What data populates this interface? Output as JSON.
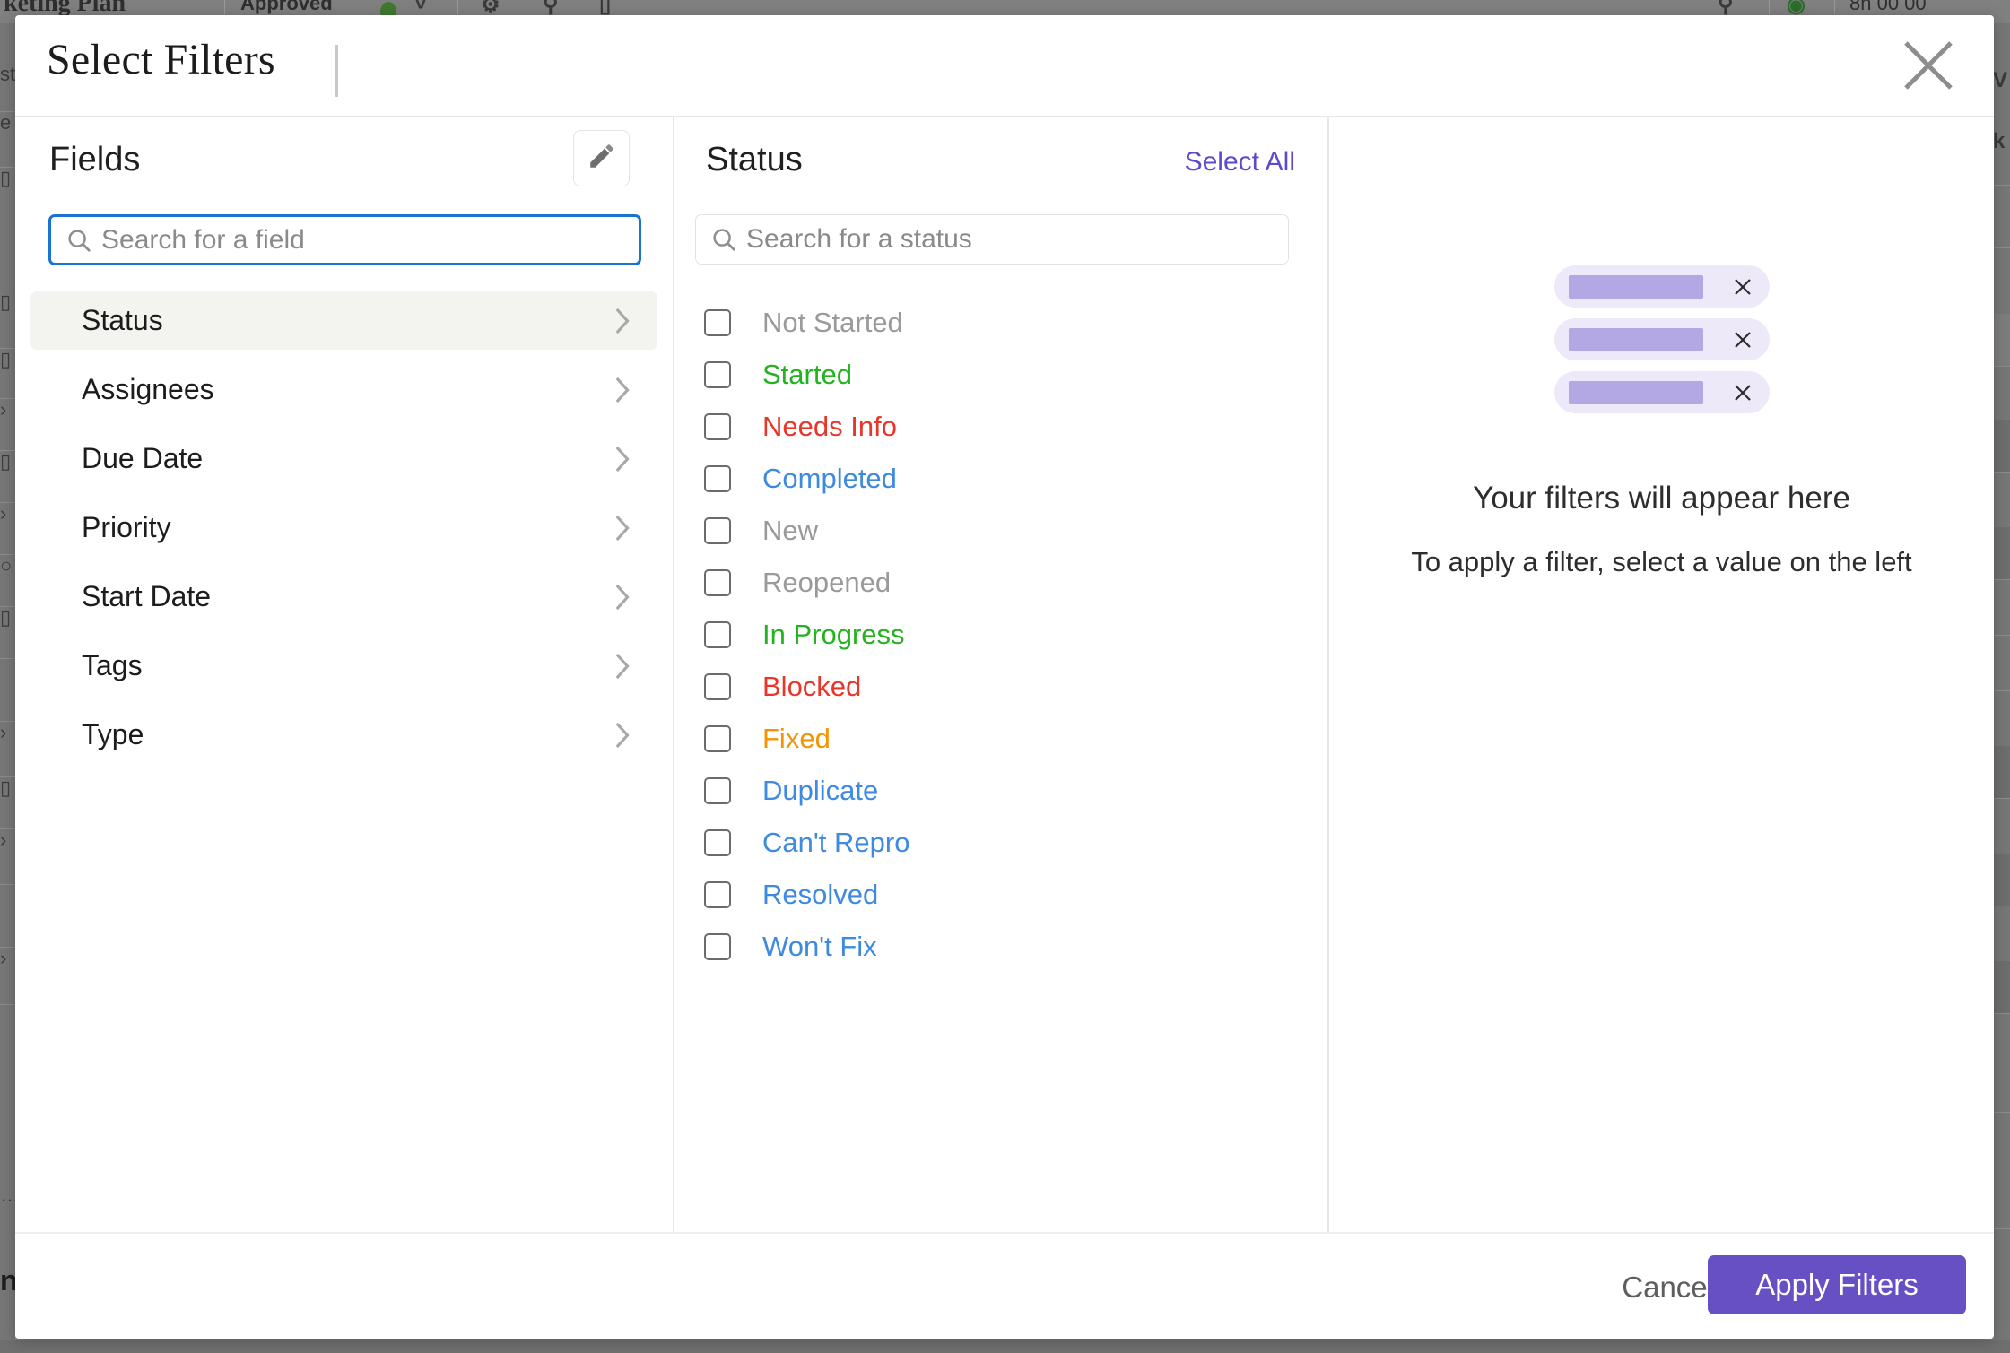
{
  "background": {
    "topbar": {
      "doc_title": "keting Plan",
      "status_label": "Approved",
      "status_dot_color": "#3f7a2e",
      "chevron_icon": "chevron-down-icon",
      "gear_icon": "gear-icon",
      "bell_off_icon": "bell-off-icon",
      "book_icon": "book-icon",
      "search_icon": "search-icon",
      "timer_icon": "timer-icon",
      "time_value": "8h 00 00"
    },
    "left_edge_labels": [
      "st",
      "e",
      "n"
    ],
    "right_edge_labels": [
      "V",
      "k E"
    ]
  },
  "modal": {
    "title": "Select Filters",
    "close_icon": "close-icon",
    "fields_panel": {
      "title": "Fields",
      "edit_icon": "pencil-icon",
      "search": {
        "icon": "search-icon",
        "placeholder": "Search for a field",
        "value": ""
      },
      "items": [
        {
          "label": "Status",
          "selected": true,
          "chevron": "chevron-right-icon"
        },
        {
          "label": "Assignees",
          "selected": false,
          "chevron": "chevron-right-icon"
        },
        {
          "label": "Due Date",
          "selected": false,
          "chevron": "chevron-right-icon"
        },
        {
          "label": "Priority",
          "selected": false,
          "chevron": "chevron-right-icon"
        },
        {
          "label": "Start Date",
          "selected": false,
          "chevron": "chevron-right-icon"
        },
        {
          "label": "Tags",
          "selected": false,
          "chevron": "chevron-right-icon"
        },
        {
          "label": "Type",
          "selected": false,
          "chevron": "chevron-right-icon"
        }
      ]
    },
    "values_panel": {
      "title": "Status",
      "select_all_label": "Select All",
      "select_all_color": "#5b4bcc",
      "search": {
        "icon": "search-icon",
        "placeholder": "Search for a status",
        "value": ""
      },
      "options": [
        {
          "label": "Not Started",
          "color": "#9a9a9a",
          "checked": false
        },
        {
          "label": "Started",
          "color": "#23b31f",
          "checked": false
        },
        {
          "label": "Needs Info",
          "color": "#e8362a",
          "checked": false
        },
        {
          "label": "Completed",
          "color": "#3d8ae0",
          "checked": false
        },
        {
          "label": "New",
          "color": "#9a9a9a",
          "checked": false
        },
        {
          "label": "Reopened",
          "color": "#9a9a9a",
          "checked": false
        },
        {
          "label": "In Progress",
          "color": "#23b31f",
          "checked": false
        },
        {
          "label": "Blocked",
          "color": "#e8362a",
          "checked": false
        },
        {
          "label": "Fixed",
          "color": "#f59400",
          "checked": false
        },
        {
          "label": "Duplicate",
          "color": "#3d8ae0",
          "checked": false
        },
        {
          "label": "Can't Repro",
          "color": "#3d8ae0",
          "checked": false
        },
        {
          "label": "Resolved",
          "color": "#3d8ae0",
          "checked": false
        },
        {
          "label": "Won't Fix",
          "color": "#3d8ae0",
          "checked": false
        }
      ]
    },
    "preview_panel": {
      "placeholder_chips": 3,
      "chip_bg_color": "#ede9f8",
      "chip_bar_color": "#b3a7e4",
      "chip_remove_icon": "close-icon",
      "headline": "Your filters will appear here",
      "subtext": "To apply a filter, select a value on the left"
    },
    "footer": {
      "cancel_label": "Cancel",
      "apply_label": "Apply Filters",
      "apply_color": "#6650c4"
    }
  }
}
